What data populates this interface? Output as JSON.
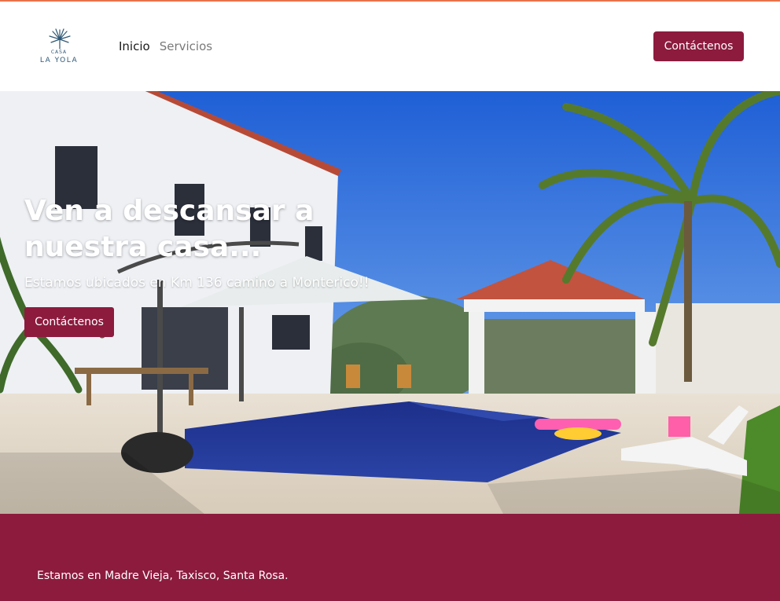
{
  "brand": {
    "logo_line1": "CASA",
    "logo_line2": "LA YOLA"
  },
  "nav": {
    "items": [
      {
        "label": "Inicio",
        "active": true
      },
      {
        "label": "Servicios",
        "active": false
      }
    ],
    "cta_label": "Contáctenos"
  },
  "hero": {
    "title": "Ven a descansar a nuestra casa...",
    "subtitle": "Estamos ubicados en Km 136 camino a Monterico!!",
    "cta_label": "Contáctenos"
  },
  "footer": {
    "text": "Estamos en Madre Vieja, Taxisco, Santa Rosa."
  },
  "colors": {
    "accent": "#8c1b3e",
    "top_rule": "#e8734a",
    "logo": "#2e5876"
  }
}
